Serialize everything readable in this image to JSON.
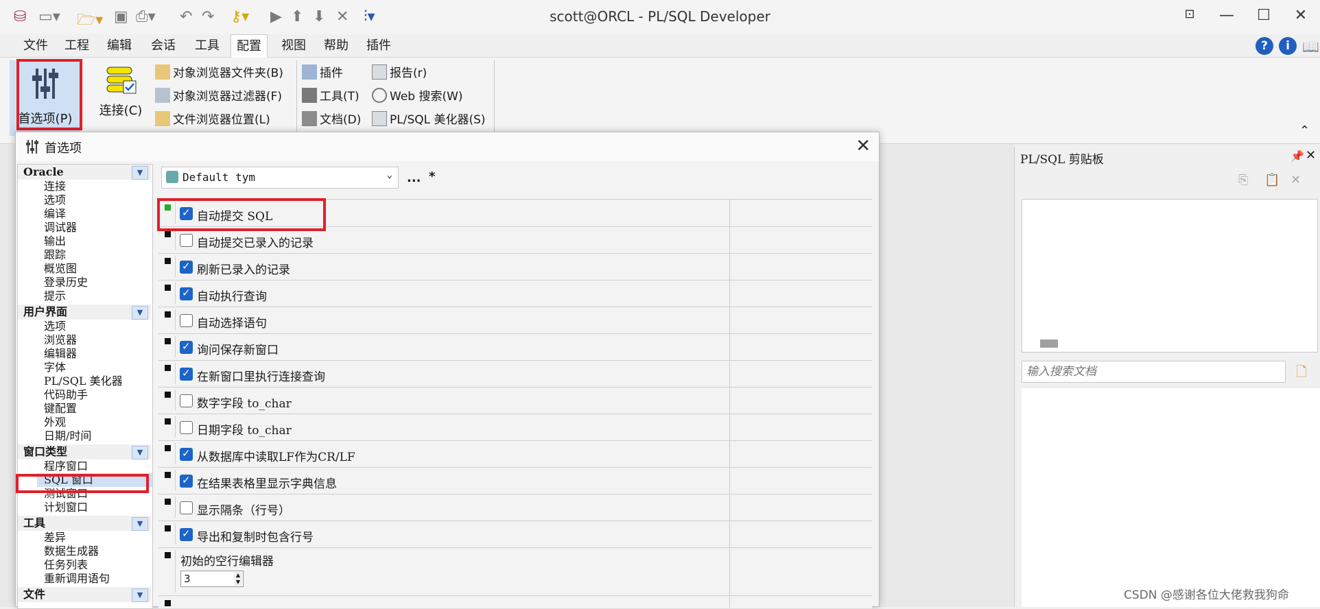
{
  "window": {
    "title": "scott@ORCL - PL/SQL Developer"
  },
  "menu": [
    "文件",
    "工程",
    "编辑",
    "会话",
    "工具",
    "配置",
    "视图",
    "帮助",
    "插件"
  ],
  "active_menu": "配置",
  "ribbon": {
    "preferences": "首选项(P)",
    "connect": "连接(C)",
    "browser_folders": "对象浏览器文件夹(B)",
    "browser_filters": "对象浏览器过滤器(F)",
    "file_browser_locations": "文件浏览器位置(L)",
    "plugins": "插件",
    "tools": "工具(T)",
    "documents": "文档(D)",
    "reports": "报告(r)",
    "web_search": "Web 搜索(W)",
    "beautifier": "PL/SQL 美化器(S)"
  },
  "dialog": {
    "title": "首选项",
    "profile": "Default tym",
    "profile_more": "...",
    "profile_modified": "*"
  },
  "tree": {
    "groups": [
      {
        "title": "Oracle",
        "items": [
          "连接",
          "选项",
          "编译",
          "调试器",
          "输出",
          "跟踪",
          "概览图",
          "登录历史",
          "提示"
        ]
      },
      {
        "title": "用户界面",
        "items": [
          "选项",
          "浏览器",
          "编辑器",
          "字体",
          "PL/SQL 美化器",
          "代码助手",
          "键配置",
          "外观",
          "日期/时间"
        ]
      },
      {
        "title": "窗口类型",
        "items": [
          "程序窗口",
          "SQL 窗口",
          "测试窗口",
          "计划窗口"
        ]
      },
      {
        "title": "工具",
        "items": [
          "差异",
          "数据生成器",
          "任务列表",
          "重新调用语句"
        ]
      },
      {
        "title": "文件",
        "items": []
      }
    ],
    "selected": "SQL 窗口"
  },
  "options": [
    {
      "label": "自动提交 SQL",
      "checked": true
    },
    {
      "label": "自动提交已录入的记录",
      "checked": false
    },
    {
      "label": "刷新已录入的记录",
      "checked": true
    },
    {
      "label": "自动执行查询",
      "checked": true
    },
    {
      "label": "自动选择语句",
      "checked": false
    },
    {
      "label": "询问保存新窗口",
      "checked": true
    },
    {
      "label": "在新窗口里执行连接查询",
      "checked": true
    },
    {
      "label": "数字字段 to_char",
      "checked": false
    },
    {
      "label": "日期字段 to_char",
      "checked": false
    },
    {
      "label": "从数据库中读取LF作为CR/LF",
      "checked": true
    },
    {
      "label": "在结果表格里显示字典信息",
      "checked": true
    },
    {
      "label": "显示隔条（行号）",
      "checked": false
    },
    {
      "label": "导出和复制时包含行号",
      "checked": true
    }
  ],
  "empty_row_editor": {
    "label": "初始的空行编辑器",
    "value": "3"
  },
  "clipboard_panel": {
    "title": "PL/SQL 剪贴板",
    "search_placeholder": "输入搜索文档"
  },
  "watermark": "CSDN @感谢各位大佬救我狗命",
  "colors": {
    "highlight_red": "#e0202a",
    "check_blue": "#1d64c8",
    "marker_green": "#1fae2a"
  }
}
